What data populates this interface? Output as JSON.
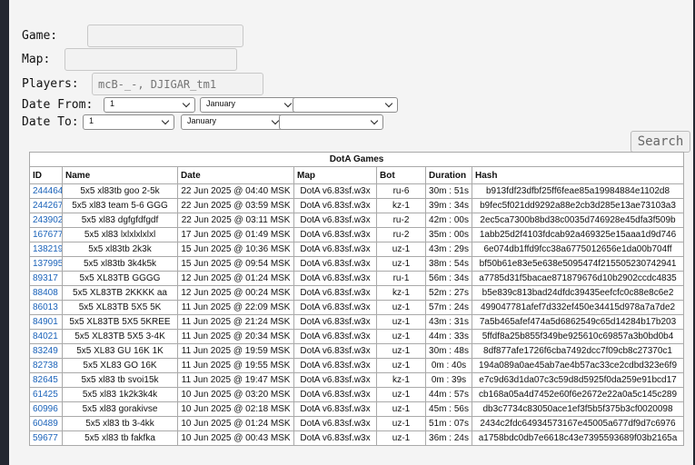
{
  "form": {
    "game_label": "Game:",
    "game_value": "",
    "map_label": "Map:",
    "map_value": "",
    "players_label": "Players:",
    "players_placeholder": "mcB-_-, DJIGAR_tm1",
    "date_from_label": "Date From:",
    "date_to_label": "Date To:",
    "from_day": "1",
    "from_month": "January",
    "from_year": "",
    "to_day": "1",
    "to_month": "January",
    "to_year": "",
    "search_label": "Search"
  },
  "table": {
    "title": "DotA Games",
    "headers": [
      "ID",
      "Name",
      "Date",
      "Map",
      "Bot",
      "Duration",
      "Hash"
    ],
    "rows": [
      [
        "244464",
        "5x5 xl83tb goo 2-5k",
        "22 Jun 2025 @ 04:40 MSK",
        "DotA v6.83sf.w3x",
        "ru-6",
        "30m : 51s",
        "b913fdf23dfbf25ff6feae85a19984884e1102d8"
      ],
      [
        "244267",
        "5x5 xl83 team 5-6 GGG",
        "22 Jun 2025 @ 03:59 MSK",
        "DotA v6.83sf.w3x",
        "kz-1",
        "39m : 34s",
        "b9fec5f021dd9292a88e2cb3d285e13ae73103a3"
      ],
      [
        "243902",
        "5x5 xl83 dgfgfdfgdf",
        "22 Jun 2025 @ 03:11 MSK",
        "DotA v6.83sf.w3x",
        "ru-2",
        "42m : 00s",
        "2ec5ca7300b8bd38c0035d746928e45dfa3f509b"
      ],
      [
        "167677",
        "5x5 xl83 lxlxlxlxlxl",
        "17 Jun 2025 @ 01:49 MSK",
        "DotA v6.83sf.w3x",
        "ru-2",
        "35m : 00s",
        "1abb25d2f4103fdcab92a469325e15aaa1d9d746"
      ],
      [
        "138219",
        "5x5 xl83tb 2k3k",
        "15 Jun 2025 @ 10:36 MSK",
        "DotA v6.83sf.w3x",
        "uz-1",
        "43m : 29s",
        "6e074db1ffd9fcc38a6775012656e1da00b704ff"
      ],
      [
        "137995",
        "5x5 xl83tb 3k4k5k",
        "15 Jun 2025 @ 09:54 MSK",
        "DotA v6.83sf.w3x",
        "uz-1",
        "38m : 54s",
        "bf50b61e83e5e638e5095474f215505230742941"
      ],
      [
        "89317",
        "5x5 XL83TB GGGG",
        "12 Jun 2025 @ 01:24 MSK",
        "DotA v6.83sf.w3x",
        "ru-1",
        "56m : 34s",
        "a7785d31f5bacae871879676d10b2902ccdc4835"
      ],
      [
        "88408",
        "5x5 XL83TB 2KKKK aa",
        "12 Jun 2025 @ 00:24 MSK",
        "DotA v6.83sf.w3x",
        "kz-1",
        "52m : 27s",
        "b5e839c813bad24dfdc39435eefcfc0c88e8c6e2"
      ],
      [
        "86013",
        "5x5 XL83TB 5X5 5K",
        "11 Jun 2025 @ 22:09 MSK",
        "DotA v6.83sf.w3x",
        "uz-1",
        "57m : 24s",
        "499047781afef7d332ef450e34415d978a7a7de2"
      ],
      [
        "84901",
        "5x5 XL83TB 5X5 5KREE",
        "11 Jun 2025 @ 21:24 MSK",
        "DotA v6.83sf.w3x",
        "uz-1",
        "43m : 31s",
        "7a5b465afef474a5d6862549c65d14284b17b203"
      ],
      [
        "84021",
        "5x5 XL83TB 5X5 3-4K",
        "11 Jun 2025 @ 20:34 MSK",
        "DotA v6.83sf.w3x",
        "uz-1",
        "44m : 33s",
        "5ffdf8a25b855f349be925610c69857a3b0bd0b4"
      ],
      [
        "83249",
        "5x5 XL83 GU 16K 1K",
        "11 Jun 2025 @ 19:59 MSK",
        "DotA v6.83sf.w3x",
        "uz-1",
        "30m : 48s",
        "8df877afe1726f6cba7492dcc7f09cb8c27370c1"
      ],
      [
        "82738",
        "5x5 XL83 GO 16K",
        "11 Jun 2025 @ 19:55 MSK",
        "DotA v6.83sf.w3x",
        "uz-1",
        "0m : 40s",
        "194a089a0ae45ab7ae4b57ac33ce2cdbd323e6f9"
      ],
      [
        "82645",
        "5x5 xl83 tb svoi15k",
        "11 Jun 2025 @ 19:47 MSK",
        "DotA v6.83sf.w3x",
        "kz-1",
        "0m : 39s",
        "e7c9d63d1da07c3c59d8d5925f0da259e91bcd17"
      ],
      [
        "61425",
        "5x5 xl83 1k2k3k4k",
        "10 Jun 2025 @ 03:20 MSK",
        "DotA v6.83sf.w3x",
        "uz-1",
        "44m : 57s",
        "cb168a05a4d7452e60f6e2672e22a0a5c145c289"
      ],
      [
        "60996",
        "5x5 xl83 gorakivse",
        "10 Jun 2025 @ 02:18 MSK",
        "DotA v6.83sf.w3x",
        "uz-1",
        "45m : 56s",
        "db3c7734c83050ace1ef3f5b5f375b3cf0020098"
      ],
      [
        "60489",
        "5x5 xl83 tb 3-4kk",
        "10 Jun 2025 @ 01:24 MSK",
        "DotA v6.83sf.w3x",
        "uz-1",
        "51m : 07s",
        "2434c2fdc64934573167e45005a677df9d7c6976"
      ],
      [
        "59677",
        "5x5 xl83 tb fakfka",
        "10 Jun 2025 @ 00:43 MSK",
        "DotA v6.83sf.w3x",
        "uz-1",
        "36m : 24s",
        "a1758bdc0db7e6618c43e7395593689f03b2165a"
      ]
    ]
  }
}
